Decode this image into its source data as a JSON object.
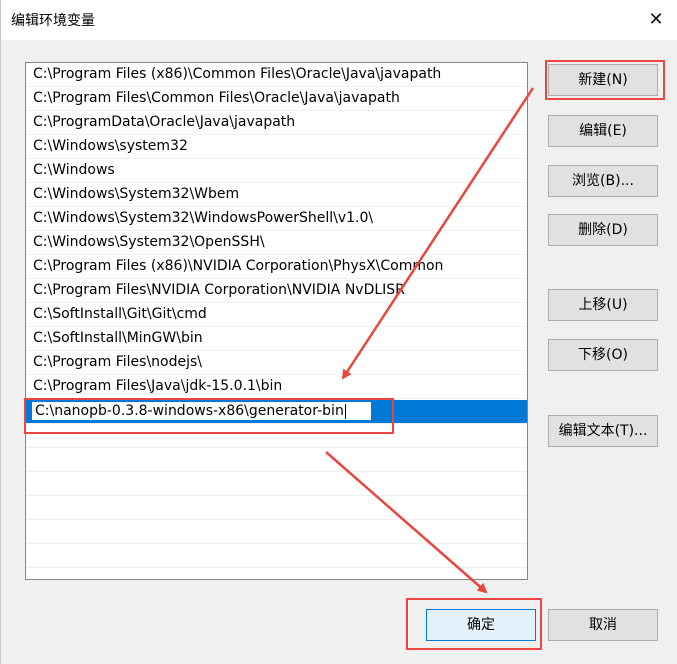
{
  "dialog": {
    "title": "编辑环境变量",
    "close_label": "✕"
  },
  "paths": [
    "C:\\Program Files (x86)\\Common Files\\Oracle\\Java\\javapath",
    "C:\\Program Files\\Common Files\\Oracle\\Java\\javapath",
    "C:\\ProgramData\\Oracle\\Java\\javapath",
    "C:\\Windows\\system32",
    "C:\\Windows",
    "C:\\Windows\\System32\\Wbem",
    "C:\\Windows\\System32\\WindowsPowerShell\\v1.0\\",
    "C:\\Windows\\System32\\OpenSSH\\",
    "C:\\Program Files (x86)\\NVIDIA Corporation\\PhysX\\Common",
    "C:\\Program Files\\NVIDIA Corporation\\NVIDIA NvDLISR",
    "C:\\SoftInstall\\Git\\Git\\cmd",
    "C:\\SoftInstall\\MinGW\\bin",
    "C:\\Program Files\\nodejs\\",
    "C:\\Program Files\\Java\\jdk-15.0.1\\bin"
  ],
  "editing_value": "C:\\nanopb-0.3.8-windows-x86\\generator-bin",
  "buttons": {
    "new": "新建(N)",
    "edit": "编辑(E)",
    "browse": "浏览(B)...",
    "delete": "删除(D)",
    "move_up": "上移(U)",
    "move_down": "下移(O)",
    "edit_text": "编辑文本(T)...",
    "ok": "确定",
    "cancel": "取消"
  },
  "colors": {
    "annotation": "#e8463e",
    "selection": "#0078d7"
  }
}
